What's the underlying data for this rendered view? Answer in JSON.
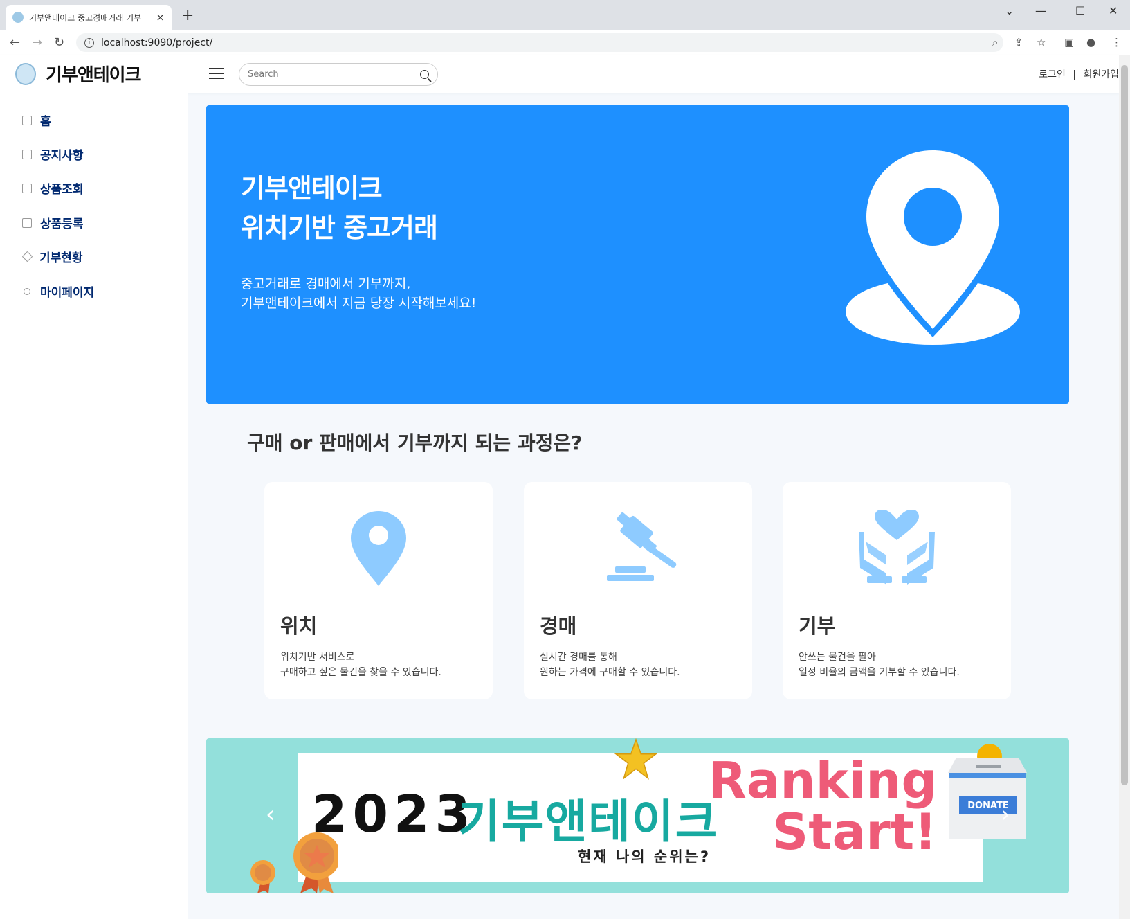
{
  "browser": {
    "tab_title": "기부앤테이크 중고경매거래 기부",
    "tab_close": "×",
    "new_tab": "+",
    "url": "localhost:9090/project/",
    "controls": {
      "chevron": "⌄",
      "minimize": "—",
      "maximize": "☐",
      "close": "✕"
    },
    "nav": {
      "back": "←",
      "forward": "→",
      "reload": "↻"
    },
    "info": "i",
    "icons": [
      "zoom-icon",
      "share-icon",
      "star-icon",
      "sidepanel-icon",
      "profile-icon",
      "menu-icon"
    ]
  },
  "header": {
    "logo_text": "기부앤테이크",
    "search_placeholder": "Search",
    "login": "로그인",
    "separator": "|",
    "signup": "회원가입"
  },
  "sidebar": {
    "items": [
      {
        "label": "홈",
        "icon": "grid-icon"
      },
      {
        "label": "공지사항",
        "icon": "journal-icon"
      },
      {
        "label": "상품조회",
        "icon": "table-icon"
      },
      {
        "label": "상품등록",
        "icon": "table-icon"
      },
      {
        "label": "기부현황",
        "icon": "gem-icon"
      },
      {
        "label": "마이페이지",
        "icon": "person-icon"
      }
    ]
  },
  "hero": {
    "title_line1": "기부앤테이크",
    "title_line2": "위치기반 중고거래",
    "sub_line1": "중고거래로 경매에서 기부까지,",
    "sub_line2": "기부앤테이크에서 지금 당장 시작해보세요!",
    "pin_color": "#ffffff",
    "background": "#1e90ff"
  },
  "process": {
    "title": "구매 or 판매에서 기부까지 되는 과정은?",
    "cards": [
      {
        "name": "위치",
        "desc1": "위치기반 서비스로",
        "desc2": "구매하고 싶은 물건을 찾을 수 있습니다.",
        "icon": "location-pin-icon"
      },
      {
        "name": "경매",
        "desc1": "실시간 경매를 통해",
        "desc2": "원하는 가격에 구매할 수 있습니다.",
        "icon": "gavel-icon"
      },
      {
        "name": "기부",
        "desc1": "안쓰는 물건을 팔아",
        "desc2": "일정 비율의 금액을 기부할 수 있습니다.",
        "icon": "heart-hands-icon"
      }
    ],
    "icon_color": "#8ecbff"
  },
  "banner": {
    "year": "2023",
    "name": "기부앤테이크",
    "ranking_line1": "Ranking",
    "ranking_line2": "Start!",
    "subtitle": "현재 나의 순위는?",
    "donate_box": "DONATE",
    "prev": "‹",
    "next": "›"
  }
}
